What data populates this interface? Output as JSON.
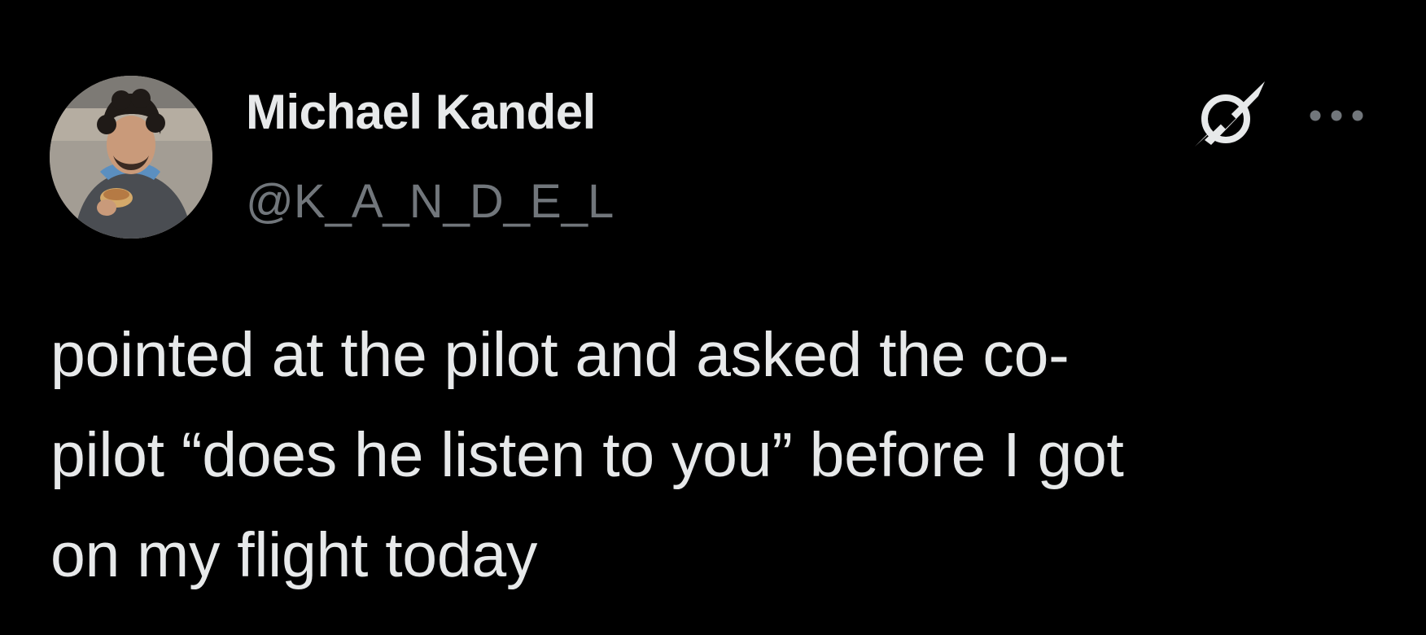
{
  "author": {
    "display_name": "Michael Kandel",
    "handle": "@K_A_N_D_E_L",
    "avatar_icon": "profile-photo"
  },
  "header_actions": {
    "grok_icon": "grok-icon",
    "more_icon": "more-options-icon"
  },
  "tweet": {
    "lines": [
      "pointed at the pilot and asked the co-",
      "pilot “does he listen to you” before I got",
      "on my flight today"
    ]
  },
  "colors": {
    "background": "#000000",
    "primary_text": "#e7e9ea",
    "secondary_text": "#71767b"
  }
}
